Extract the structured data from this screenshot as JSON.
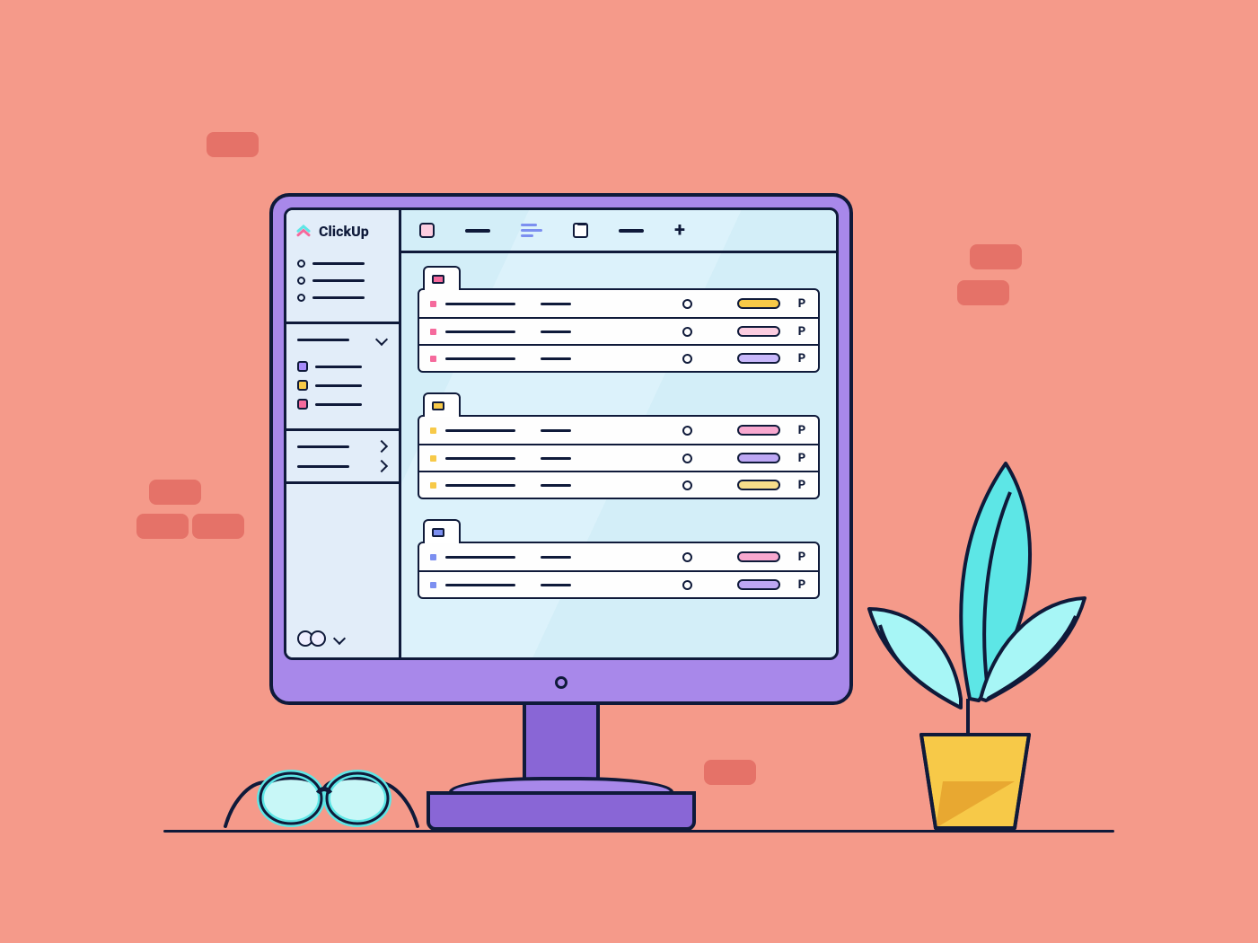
{
  "app": {
    "name": "ClickUp"
  },
  "sidebar": {
    "nav_items": [
      {
        "id": "nav-1"
      },
      {
        "id": "nav-2"
      },
      {
        "id": "nav-3"
      }
    ],
    "spaces": [
      {
        "color": "#a78bfa"
      },
      {
        "color": "#f7c948"
      },
      {
        "color": "#f56a9c"
      }
    ],
    "folders": [
      {
        "id": "f1"
      },
      {
        "id": "f2"
      }
    ]
  },
  "tabs": [
    {
      "kind": "list",
      "active": true
    },
    {
      "kind": "dash"
    },
    {
      "kind": "gantt"
    },
    {
      "kind": "board"
    },
    {
      "kind": "dash"
    },
    {
      "kind": "add"
    }
  ],
  "groups": [
    {
      "color": "#f56a9c",
      "tasks": [
        {
          "bullet": "#f56a9c",
          "pill": "#f7c948",
          "flag": "P"
        },
        {
          "bullet": "#f56a9c",
          "pill": "#fccde0",
          "flag": "P"
        },
        {
          "bullet": "#f56a9c",
          "pill": "#c9b8fb",
          "flag": "P"
        }
      ]
    },
    {
      "color": "#f7c948",
      "tasks": [
        {
          "bullet": "#f7c948",
          "pill": "#f8a8cf",
          "flag": "P"
        },
        {
          "bullet": "#f7c948",
          "pill": "#bda7f4",
          "flag": "P"
        },
        {
          "bullet": "#f7c948",
          "pill": "#f7dd8a",
          "flag": "P"
        }
      ]
    },
    {
      "color": "#7c8ff0",
      "tasks": [
        {
          "bullet": "#7c8ff0",
          "pill": "#f8a8cf",
          "flag": "P"
        },
        {
          "bullet": "#7c8ff0",
          "pill": "#bda7f4",
          "flag": "P"
        }
      ]
    }
  ]
}
